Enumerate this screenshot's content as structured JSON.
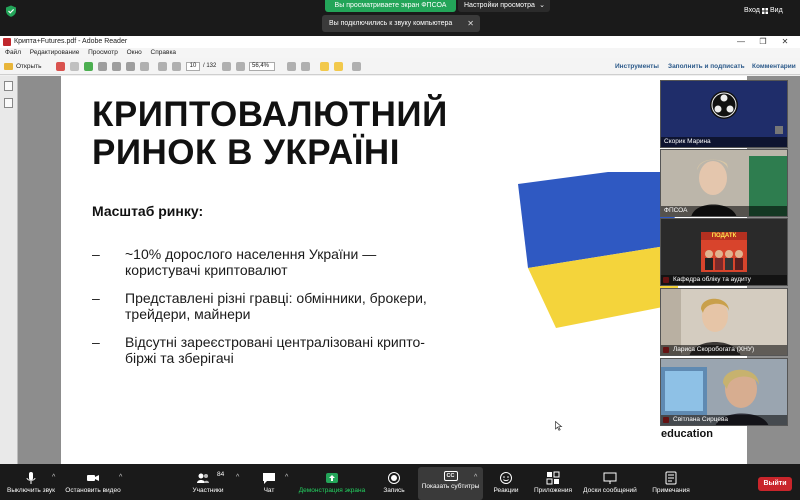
{
  "zoom_top": {
    "share_banner": "Вы просматриваете экран ФПСОА",
    "view_options": "Настройки просмотра",
    "audio_toast": "Вы подключились к звуку компьютера",
    "enter": "Вход",
    "view": "Вид"
  },
  "adobe": {
    "title": "Крипта+Futures.pdf - Adobe Reader",
    "menu": [
      "Файл",
      "Редактирование",
      "Просмотр",
      "Окно",
      "Справка"
    ],
    "open": "Открыть",
    "page_current": "10",
    "page_total": "/ 132",
    "zoom_level": "56,4%",
    "tools": "Инструменты",
    "fill_sign": "Заполнить и подписать",
    "comment": "Комментарии"
  },
  "slide": {
    "title_line1": "КРИПТОВАЛЮТНИЙ",
    "title_line2": "РИНОК В УКРАЇНІ",
    "subtitle": "Масштаб ринку:",
    "bullets": [
      {
        "dash": "–",
        "line1": "~10% дорослого населення України —",
        "line2": "користувачі криптовалют"
      },
      {
        "dash": "–",
        "line1": "Представлені різні гравці: обмінники, брокери,",
        "line2": "трейдери, майнери"
      },
      {
        "dash": "–",
        "line1": "Відсутні зареєстровані централізовані крипто-",
        "line2": "біржі та зберігачі"
      }
    ],
    "flag_blue": "#2f59c2",
    "flag_yellow": "#f4d43b",
    "edu": "education"
  },
  "participants": [
    {
      "name": "Скорик Марина"
    },
    {
      "name": "ФПСОА"
    },
    {
      "name": "Кафедра обліку та аудиту",
      "banner": "ПОДАТК"
    },
    {
      "name": "Лариса Скоробогата (ХНУ)"
    },
    {
      "name": "Світлана Сирцева"
    }
  ],
  "zoom_bottom": {
    "mute": "Выключить звук",
    "stop_video": "Остановить видео",
    "participants_label": "Участники",
    "participants_count": "84",
    "chat": "Чат",
    "share": "Демонстрация экрана",
    "record": "Запись",
    "captions": "Показать субтитры",
    "cc": "CC",
    "reactions": "Реакции",
    "apps": "Приложения",
    "whiteboards": "Доски сообщений",
    "notes": "Примечания",
    "leave": "Выйти"
  }
}
